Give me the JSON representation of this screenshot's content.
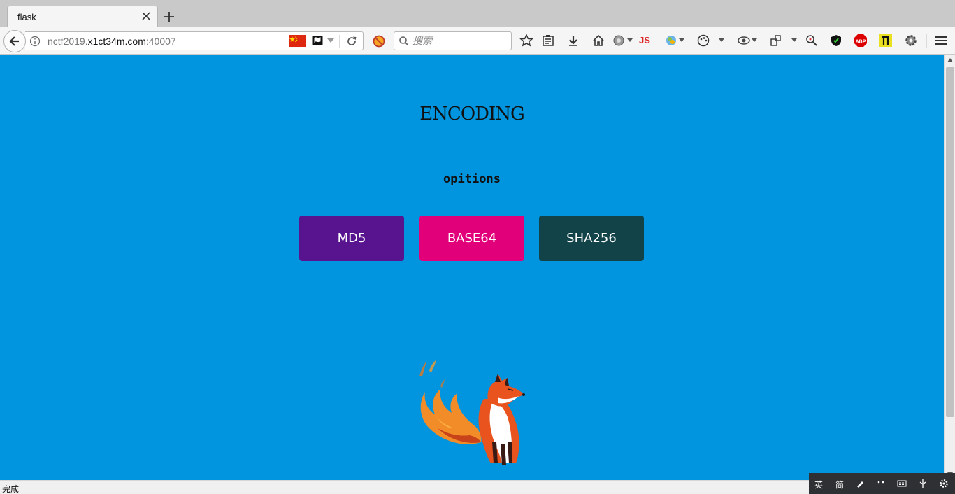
{
  "browser": {
    "tab_title": "flask",
    "url_prefix": "nctf2019.",
    "url_host": "x1ct34m.com",
    "url_suffix": ":40007",
    "search_placeholder": "搜索",
    "toolbar_js_label": "JS"
  },
  "page": {
    "heading": "ENCODING",
    "subheading": "opitions",
    "buttons": [
      {
        "label": "MD5",
        "color": "#58148e"
      },
      {
        "label": "BASE64",
        "color": "#e2007a"
      },
      {
        "label": "SHA256",
        "color": "#114349"
      }
    ],
    "background_color": "#0095de"
  },
  "status": {
    "text": "完成"
  },
  "ime": {
    "lang": "英",
    "mode": "简"
  },
  "icons": [
    "back-arrow-icon",
    "info-icon",
    "china-flag-icon",
    "reload-icon",
    "search-icon",
    "bookmark-star-icon",
    "reader-icon",
    "download-icon",
    "home-icon",
    "gear-icon",
    "shield-icon",
    "abp-icon",
    "menu-icon",
    "fox-icon"
  ]
}
